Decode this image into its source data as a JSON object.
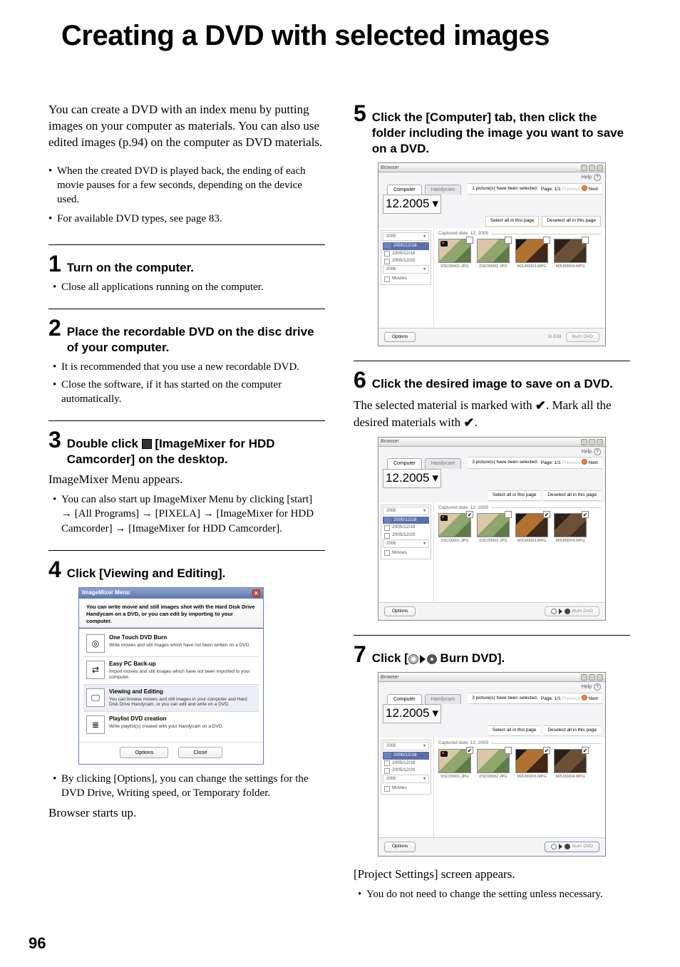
{
  "page_number": "96",
  "title": "Creating a DVD with selected images",
  "intro": "You can create a DVD with an index menu by putting images on your computer as materials. You can also use edited images (p.94) on the computer as DVD materials.",
  "notes": [
    "When the created DVD is played back, the ending of each movie pauses for a few seconds, depending on the device used.",
    "For available DVD types, see page 83."
  ],
  "steps": {
    "s1": {
      "num": "1",
      "title": "Turn on the computer.",
      "subs": [
        "Close all applications running on the computer."
      ]
    },
    "s2": {
      "num": "2",
      "title": "Place the recordable DVD on the disc drive of your computer.",
      "subs": [
        "It is recommended that you use a new recordable DVD.",
        "Close the software, if it has started on the computer automatically."
      ]
    },
    "s3": {
      "num": "3",
      "title_pre": "Double click ",
      "title_post": " [ImageMixer for HDD Camcorder] on the desktop.",
      "body": "ImageMixer Menu appears.",
      "subs": [
        "You can also start up ImageMixer Menu by clicking [start] → [All Programs] → [PIXELA] → [ImageMixer for HDD Camcorder] → [ImageMixer for HDD Camcorder]."
      ]
    },
    "s4": {
      "num": "4",
      "title": "Click [Viewing and Editing].",
      "subs": [
        "By clicking [Options], you can change the settings for the DVD Drive, Writing speed, or Temporary folder."
      ],
      "tail": "Browser starts up."
    },
    "s5": {
      "num": "5",
      "title": "Click the [Computer] tab, then click the folder including the image you want to save on a DVD."
    },
    "s6": {
      "num": "6",
      "title": "Click the desired image to save on a DVD.",
      "body1": "The selected material is marked with ",
      "body2": ". Mark all the desired materials with ",
      "body3": "."
    },
    "s7": {
      "num": "7",
      "title_pre": "Click [",
      "title_post": " Burn DVD].",
      "tail": "[Project Settings] screen appears.",
      "subs": [
        "You do not need to change the setting unless necessary."
      ]
    }
  },
  "im_menu": {
    "window_title": "ImageMixer Menu",
    "desc": "You can write movie and still images shot with the Hard Disk Drive Handycam on a DVD, or you can edit by importing to your computer.",
    "items": [
      {
        "title": "One Touch DVD Burn",
        "desc": "Write movies and still images which have not been written on a DVD."
      },
      {
        "title": "Easy PC Back-up",
        "desc": "Import movies and still images which have not been imported to your computer."
      },
      {
        "title": "Viewing and Editing",
        "desc": "You can browse movies and still images in your computer and Hard Disk Drive Handycam, or you can edit and write on a DVD."
      },
      {
        "title": "Playlist DVD creation",
        "desc": "Write playlist(s) created with your Handycam on a DVD."
      }
    ],
    "buttons": {
      "options": "Options",
      "close": "Close"
    }
  },
  "browser": {
    "title": "Browser",
    "help": "Help",
    "tab_computer": "Computer",
    "tab_handycam": "Handycam",
    "dropdown": "12.2005",
    "year": "2005",
    "dates": [
      "2005/12/18",
      "2005/12/20"
    ],
    "year_lower": "2006",
    "movies": "Movies",
    "status_1": "1 picture(s) have been selected.",
    "status_3": "3 picture(s) have been selected.",
    "page": "Page: 1/1",
    "prev": "Previous",
    "next": "Next",
    "sel_all": "Select all in this page",
    "desel_all": "Deselect all in this page",
    "captured": "Captured date: 12, 2005",
    "thumbs": [
      "DSC00001.JPG",
      "DSC00002.JPG",
      "M2U00003.MPG",
      "M2U00004.MPG"
    ],
    "options": "Options",
    "burn": "Burn DVD",
    "to_edit": "to Edit"
  }
}
